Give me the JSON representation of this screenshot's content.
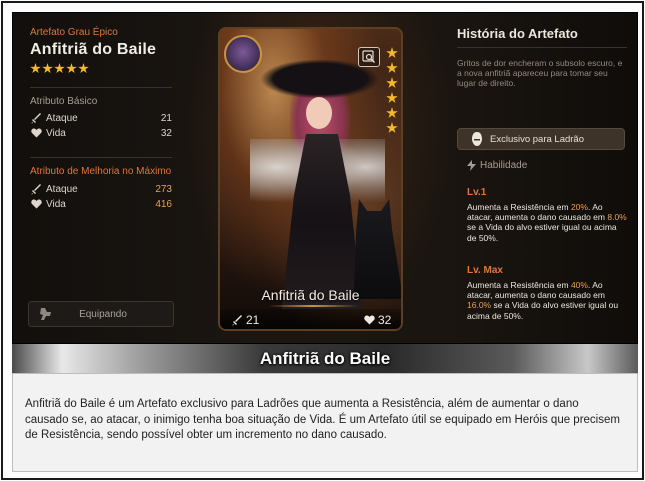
{
  "artifact": {
    "grade": "Artefato Grau Épico",
    "name": "Anfitriã do Baile",
    "stars": 5
  },
  "base_attributes": {
    "title": "Atributo Básico",
    "stats": [
      {
        "label": "Ataque",
        "value": "21",
        "icon": "sword-icon"
      },
      {
        "label": "Vida",
        "value": "32",
        "icon": "heart-icon"
      }
    ]
  },
  "max_attributes": {
    "title": "Atributo de Melhoria no Máximo",
    "stats": [
      {
        "label": "Ataque",
        "value": "273",
        "icon": "sword-icon"
      },
      {
        "label": "Vida",
        "value": "416",
        "icon": "heart-icon"
      }
    ]
  },
  "equip_button": {
    "label": "Equipando"
  },
  "card": {
    "name": "Anfitriã do Baile",
    "attack": "21",
    "health": "32",
    "stars": 6
  },
  "history": {
    "title": "História do Artefato",
    "text": "Gritos de dor encheram o subsolo escuro, e a nova anfitriã apareceu para tomar seu lugar de direito."
  },
  "exclusive": {
    "label": "Exclusivo para Ladrão"
  },
  "skill": {
    "title": "Habilidade",
    "lv1": {
      "label": "Lv.1",
      "text_a": "Aumenta a Resistência em ",
      "val1": "20%",
      "text_b": ". Ao atacar, aumenta o dano causado em ",
      "val2": "8.0%",
      "text_c": " se a Vida do alvo estiver igual ou acima de 50%."
    },
    "lvmax": {
      "label": "Lv. Max",
      "text_a": "Aumenta a Resistência em ",
      "val1": "40%",
      "text_b": ". Ao atacar, aumenta o dano causado em ",
      "val2": "16.0%",
      "text_c": " se a Vida do alvo estiver igual ou acima de 50%."
    }
  },
  "caption": {
    "title": "Anfitriã do Baile",
    "description": "Anfitriã do Baile é um Artefato exclusivo para Ladrões que aumenta a Resistência, além de aumentar o dano causado se, ao atacar, o inimigo tenha boa situação de Vida. É um Artefato útil se equipado em Heróis que precisem de Resistência, sendo possível obter um incremento no dano causado."
  },
  "colors": {
    "accent_orange": "#e0763a",
    "highlight": "#e8a14a",
    "star": "#f2b92a"
  }
}
